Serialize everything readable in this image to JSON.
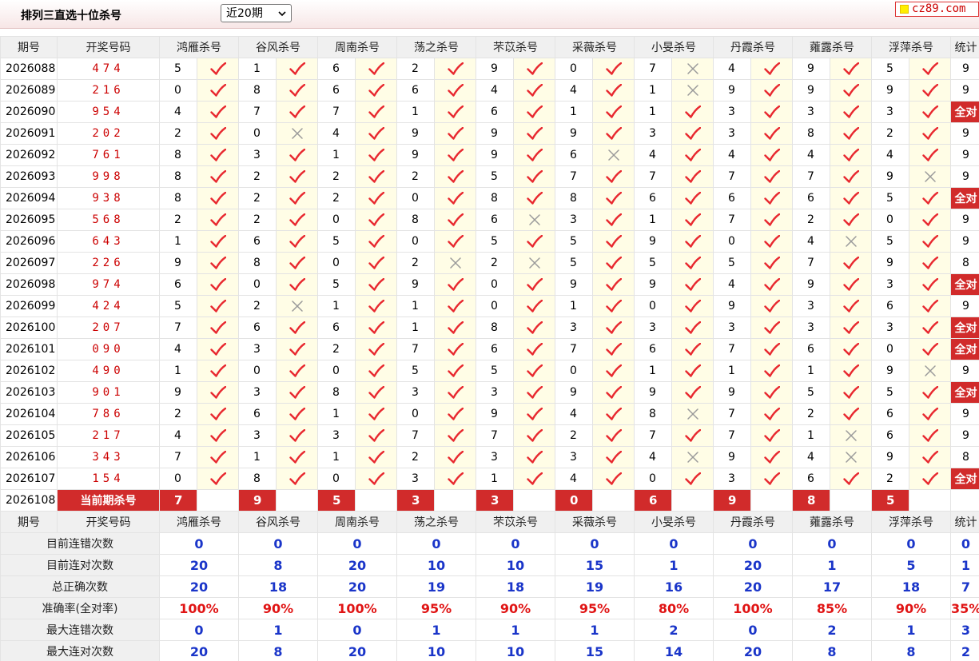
{
  "header": {
    "title": "排列三直选十位杀号",
    "period_select": "近20期",
    "site_badge": "cz89.com"
  },
  "columns": {
    "issue": "期号",
    "draw": "开奖号码",
    "experts": [
      "鸿雁杀号",
      "谷风杀号",
      "周南杀号",
      "荡之杀号",
      "芣苡杀号",
      "采薇杀号",
      "小旻杀号",
      "丹霞杀号",
      "蕹露杀号",
      "浮萍杀号"
    ],
    "stat": "统计"
  },
  "rows": [
    {
      "issue": "2026088",
      "draw": "474",
      "kills": [
        "5",
        "1",
        "6",
        "2",
        "9",
        "0",
        "7",
        "4",
        "9",
        "5"
      ],
      "ok": [
        1,
        1,
        1,
        1,
        1,
        1,
        0,
        1,
        1,
        1
      ],
      "stat": "9"
    },
    {
      "issue": "2026089",
      "draw": "216",
      "kills": [
        "0",
        "8",
        "6",
        "6",
        "4",
        "4",
        "1",
        "9",
        "9",
        "9"
      ],
      "ok": [
        1,
        1,
        1,
        1,
        1,
        1,
        0,
        1,
        1,
        1
      ],
      "stat": "9"
    },
    {
      "issue": "2026090",
      "draw": "954",
      "kills": [
        "4",
        "7",
        "7",
        "1",
        "6",
        "1",
        "1",
        "3",
        "3",
        "3"
      ],
      "ok": [
        1,
        1,
        1,
        1,
        1,
        1,
        1,
        1,
        1,
        1
      ],
      "stat": "全对"
    },
    {
      "issue": "2026091",
      "draw": "202",
      "kills": [
        "2",
        "0",
        "4",
        "9",
        "9",
        "9",
        "3",
        "3",
        "8",
        "2"
      ],
      "ok": [
        1,
        0,
        1,
        1,
        1,
        1,
        1,
        1,
        1,
        1
      ],
      "stat": "9"
    },
    {
      "issue": "2026092",
      "draw": "761",
      "kills": [
        "8",
        "3",
        "1",
        "9",
        "9",
        "6",
        "4",
        "4",
        "4",
        "4"
      ],
      "ok": [
        1,
        1,
        1,
        1,
        1,
        0,
        1,
        1,
        1,
        1
      ],
      "stat": "9"
    },
    {
      "issue": "2026093",
      "draw": "998",
      "kills": [
        "8",
        "2",
        "2",
        "2",
        "5",
        "7",
        "7",
        "7",
        "7",
        "9"
      ],
      "ok": [
        1,
        1,
        1,
        1,
        1,
        1,
        1,
        1,
        1,
        0
      ],
      "stat": "9"
    },
    {
      "issue": "2026094",
      "draw": "938",
      "kills": [
        "8",
        "2",
        "2",
        "0",
        "8",
        "8",
        "6",
        "6",
        "6",
        "5"
      ],
      "ok": [
        1,
        1,
        1,
        1,
        1,
        1,
        1,
        1,
        1,
        1
      ],
      "stat": "全对"
    },
    {
      "issue": "2026095",
      "draw": "568",
      "kills": [
        "2",
        "2",
        "0",
        "8",
        "6",
        "3",
        "1",
        "7",
        "2",
        "0"
      ],
      "ok": [
        1,
        1,
        1,
        1,
        0,
        1,
        1,
        1,
        1,
        1
      ],
      "stat": "9"
    },
    {
      "issue": "2026096",
      "draw": "643",
      "kills": [
        "1",
        "6",
        "5",
        "0",
        "5",
        "5",
        "9",
        "0",
        "4",
        "5"
      ],
      "ok": [
        1,
        1,
        1,
        1,
        1,
        1,
        1,
        1,
        0,
        1
      ],
      "stat": "9"
    },
    {
      "issue": "2026097",
      "draw": "226",
      "kills": [
        "9",
        "8",
        "0",
        "2",
        "2",
        "5",
        "5",
        "5",
        "7",
        "9"
      ],
      "ok": [
        1,
        1,
        1,
        0,
        0,
        1,
        1,
        1,
        1,
        1
      ],
      "stat": "8"
    },
    {
      "issue": "2026098",
      "draw": "974",
      "kills": [
        "6",
        "0",
        "5",
        "9",
        "0",
        "9",
        "9",
        "4",
        "9",
        "3"
      ],
      "ok": [
        1,
        1,
        1,
        1,
        1,
        1,
        1,
        1,
        1,
        1
      ],
      "stat": "全对"
    },
    {
      "issue": "2026099",
      "draw": "424",
      "kills": [
        "5",
        "2",
        "1",
        "1",
        "0",
        "1",
        "0",
        "9",
        "3",
        "6"
      ],
      "ok": [
        1,
        0,
        1,
        1,
        1,
        1,
        1,
        1,
        1,
        1
      ],
      "stat": "9"
    },
    {
      "issue": "2026100",
      "draw": "207",
      "kills": [
        "7",
        "6",
        "6",
        "1",
        "8",
        "3",
        "3",
        "3",
        "3",
        "3"
      ],
      "ok": [
        1,
        1,
        1,
        1,
        1,
        1,
        1,
        1,
        1,
        1
      ],
      "stat": "全对"
    },
    {
      "issue": "2026101",
      "draw": "090",
      "kills": [
        "4",
        "3",
        "2",
        "7",
        "6",
        "7",
        "6",
        "7",
        "6",
        "0"
      ],
      "ok": [
        1,
        1,
        1,
        1,
        1,
        1,
        1,
        1,
        1,
        1
      ],
      "stat": "全对"
    },
    {
      "issue": "2026102",
      "draw": "490",
      "kills": [
        "1",
        "0",
        "0",
        "5",
        "5",
        "0",
        "1",
        "1",
        "1",
        "9"
      ],
      "ok": [
        1,
        1,
        1,
        1,
        1,
        1,
        1,
        1,
        1,
        0
      ],
      "stat": "9"
    },
    {
      "issue": "2026103",
      "draw": "901",
      "kills": [
        "9",
        "3",
        "8",
        "3",
        "3",
        "9",
        "9",
        "9",
        "5",
        "5"
      ],
      "ok": [
        1,
        1,
        1,
        1,
        1,
        1,
        1,
        1,
        1,
        1
      ],
      "stat": "全对"
    },
    {
      "issue": "2026104",
      "draw": "786",
      "kills": [
        "2",
        "6",
        "1",
        "0",
        "9",
        "4",
        "8",
        "7",
        "2",
        "6"
      ],
      "ok": [
        1,
        1,
        1,
        1,
        1,
        1,
        0,
        1,
        1,
        1
      ],
      "stat": "9"
    },
    {
      "issue": "2026105",
      "draw": "217",
      "kills": [
        "4",
        "3",
        "3",
        "7",
        "7",
        "2",
        "7",
        "7",
        "1",
        "6"
      ],
      "ok": [
        1,
        1,
        1,
        1,
        1,
        1,
        1,
        1,
        0,
        1
      ],
      "stat": "9"
    },
    {
      "issue": "2026106",
      "draw": "343",
      "kills": [
        "7",
        "1",
        "1",
        "2",
        "3",
        "3",
        "4",
        "9",
        "4",
        "9"
      ],
      "ok": [
        1,
        1,
        1,
        1,
        1,
        1,
        0,
        1,
        0,
        1
      ],
      "stat": "8"
    },
    {
      "issue": "2026107",
      "draw": "154",
      "kills": [
        "0",
        "8",
        "0",
        "3",
        "1",
        "4",
        "0",
        "3",
        "6",
        "2"
      ],
      "ok": [
        1,
        1,
        1,
        1,
        1,
        1,
        1,
        1,
        1,
        1
      ],
      "stat": "全对"
    }
  ],
  "current": {
    "issue": "2026108",
    "label": "当前期杀号",
    "kills": [
      "7",
      "9",
      "5",
      "3",
      "3",
      "0",
      "6",
      "9",
      "8",
      "5"
    ]
  },
  "summary_header": {
    "issue": "期号",
    "draw": "开奖号码",
    "stat": "统计"
  },
  "summary": [
    {
      "label": "目前连错次数",
      "values": [
        "0",
        "0",
        "0",
        "0",
        "0",
        "0",
        "0",
        "0",
        "0",
        "0"
      ],
      "stat": "0",
      "style": "val"
    },
    {
      "label": "目前连对次数",
      "values": [
        "20",
        "8",
        "20",
        "10",
        "10",
        "15",
        "1",
        "20",
        "1",
        "5"
      ],
      "stat": "1",
      "style": "val"
    },
    {
      "label": "总正确次数",
      "values": [
        "20",
        "18",
        "20",
        "19",
        "18",
        "19",
        "16",
        "20",
        "17",
        "18"
      ],
      "stat": "7",
      "style": "val"
    },
    {
      "label": "准确率(全对率)",
      "values": [
        "100%",
        "90%",
        "100%",
        "95%",
        "90%",
        "95%",
        "80%",
        "100%",
        "85%",
        "90%"
      ],
      "stat": "35%",
      "style": "rate"
    },
    {
      "label": "最大连错次数",
      "values": [
        "0",
        "1",
        "0",
        "1",
        "1",
        "1",
        "2",
        "0",
        "2",
        "1"
      ],
      "stat": "3",
      "style": "val"
    },
    {
      "label": "最大连对次数",
      "values": [
        "20",
        "8",
        "20",
        "10",
        "10",
        "15",
        "14",
        "20",
        "8",
        "8"
      ],
      "stat": "2",
      "style": "val"
    }
  ],
  "colors": {
    "check": "#e8282f",
    "cross": "#9a9a9a",
    "accent_red": "#d12b2b",
    "summary_blue": "#1a35c9"
  },
  "icons": {
    "correct": "checkmark-icon",
    "wrong": "cross-icon"
  }
}
